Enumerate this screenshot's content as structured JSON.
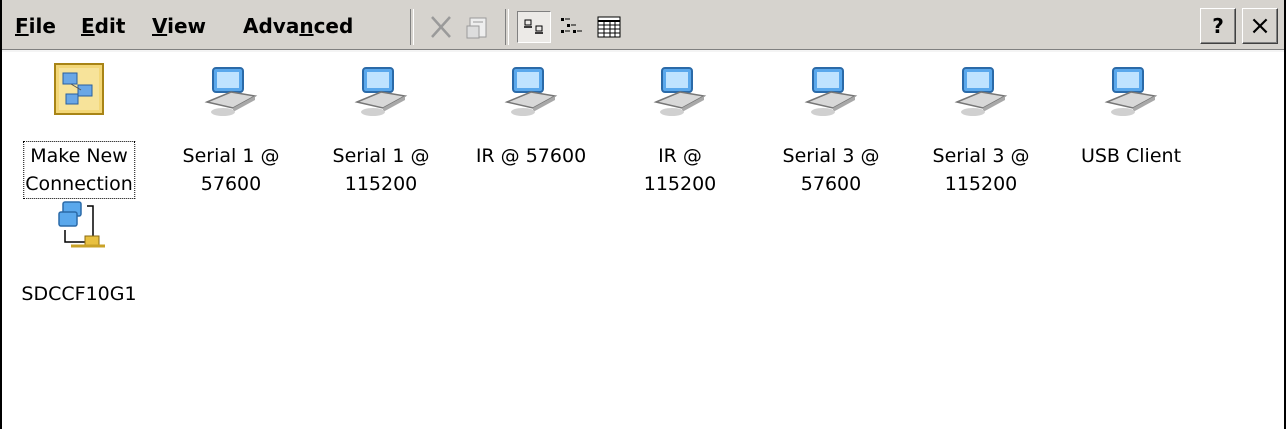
{
  "menu": {
    "file": "File",
    "edit": "Edit",
    "view": "View",
    "advanced": "Advanced"
  },
  "toolbar": {
    "delete_icon": "delete-icon",
    "properties_icon": "properties-icon",
    "large_icons_icon": "large-icons-view-icon",
    "small_icons_icon": "small-icons-view-icon",
    "details_icon": "details-view-icon",
    "help_label": "?",
    "close_label": "×"
  },
  "connections": [
    {
      "label": "Make New\nConnection",
      "icon": "make-new-connection-icon"
    },
    {
      "label": "Serial 1 @\n57600",
      "icon": "computer-connection-icon"
    },
    {
      "label": "Serial 1 @\n115200",
      "icon": "computer-connection-icon"
    },
    {
      "label": "IR @ 57600",
      "icon": "computer-connection-icon"
    },
    {
      "label": "IR @\n115200",
      "icon": "computer-connection-icon"
    },
    {
      "label": "Serial 3 @\n57600",
      "icon": "computer-connection-icon"
    },
    {
      "label": "Serial 3 @\n115200",
      "icon": "computer-connection-icon"
    },
    {
      "label": "USB Client",
      "icon": "computer-connection-icon"
    },
    {
      "label": "SDCCF10G1",
      "icon": "network-connection-icon"
    }
  ],
  "colors": {
    "toolbar_bg": "#d6d3ce",
    "window_bg": "#ffffff"
  }
}
